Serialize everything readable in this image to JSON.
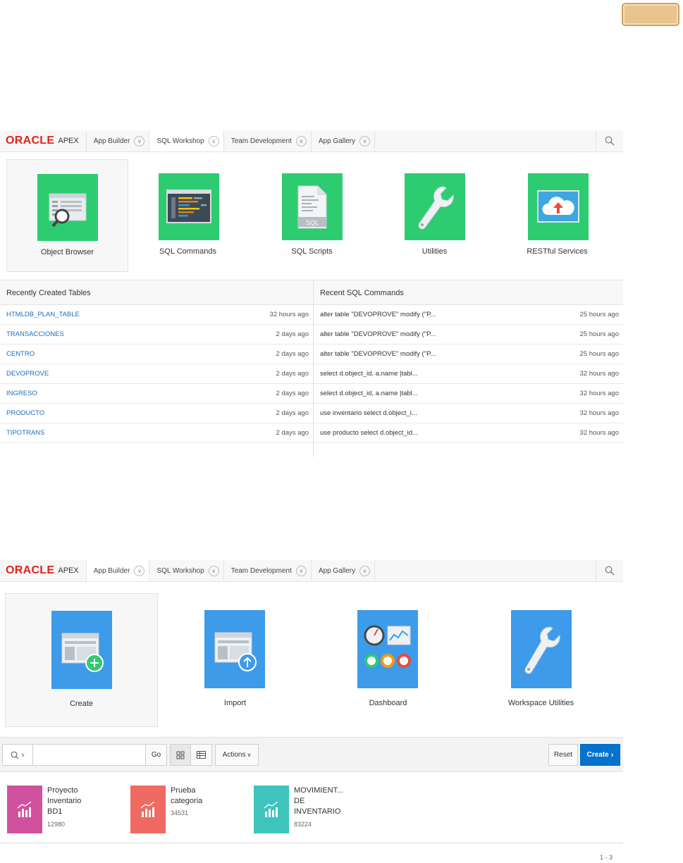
{
  "top_section": {
    "logo": {
      "brand": "ORACLE",
      "product": "APEX"
    },
    "nav": [
      {
        "label": "App Builder"
      },
      {
        "label": "SQL Workshop"
      },
      {
        "label": "Team Development"
      },
      {
        "label": "App Gallery"
      }
    ],
    "active_tab": "SQL Workshop",
    "tiles": [
      {
        "label": "Object Browser",
        "icon": "object-browser-icon",
        "selected": true
      },
      {
        "label": "SQL Commands",
        "icon": "sql-commands-icon"
      },
      {
        "label": "SQL Scripts",
        "icon": "sql-scripts-icon"
      },
      {
        "label": "Utilities",
        "icon": "wrench-icon"
      },
      {
        "label": "RESTful Services",
        "icon": "cloud-upload-icon"
      }
    ],
    "tile_color": "#2ecc71",
    "recent_tables": {
      "title": "Recently Created Tables",
      "rows": [
        {
          "name": "HTMLDB_PLAN_TABLE",
          "ago": "32 hours ago"
        },
        {
          "name": "TRANSACCIONES",
          "ago": "2 days ago"
        },
        {
          "name": "CENTRO",
          "ago": "2 days ago"
        },
        {
          "name": "DEVOPROVE",
          "ago": "2 days ago"
        },
        {
          "name": "INGRESO",
          "ago": "2 days ago"
        },
        {
          "name": "PRODUCTO",
          "ago": "2 days ago"
        },
        {
          "name": "TIPOTRANS",
          "ago": "2 days ago"
        }
      ]
    },
    "recent_sql": {
      "title": "Recent SQL Commands",
      "rows": [
        {
          "command": "alter table \"DEVOPROVE\" modify (\"P...",
          "ago": "25 hours ago"
        },
        {
          "command": "alter table \"DEVOPROVE\" modify (\"P...",
          "ago": "25 hours ago"
        },
        {
          "command": "alter table \"DEVOPROVE\" modify (\"P...",
          "ago": "25 hours ago"
        },
        {
          "command": "select d.object_id, a.name |tabl...",
          "ago": "32 hours ago"
        },
        {
          "command": "select d.object_id, a.name |tabl...",
          "ago": "32 hours ago"
        },
        {
          "command": "use inventario select d.object_i...",
          "ago": "32 hours ago"
        },
        {
          "command": "use producto select d.object_id...",
          "ago": "32 hours ago"
        }
      ]
    }
  },
  "bottom_section": {
    "logo": {
      "brand": "ORACLE",
      "product": "APEX"
    },
    "nav": [
      {
        "label": "App Builder"
      },
      {
        "label": "SQL Workshop"
      },
      {
        "label": "Team Development"
      },
      {
        "label": "App Gallery"
      }
    ],
    "active_tab": "App Builder",
    "tiles": [
      {
        "label": "Create",
        "icon": "create-app-icon",
        "selected": true
      },
      {
        "label": "Import",
        "icon": "import-icon"
      },
      {
        "label": "Dashboard",
        "icon": "dashboard-icon"
      },
      {
        "label": "Workspace Utilities",
        "icon": "wrench-icon"
      }
    ],
    "tile_color": "#3d9be9",
    "toolbar": {
      "search_value": "",
      "go_label": "Go",
      "actions_label": "Actions",
      "reset_label": "Reset",
      "create_label": "Create"
    },
    "apps": [
      {
        "name": "Proyecto Inventario BD1",
        "id": "12980",
        "color": "#d0529f"
      },
      {
        "name": "Prueba categoria",
        "id": "34531",
        "color": "#ee6a63"
      },
      {
        "name": "MOVIMIENT... DE INVENTARIO",
        "id": "83224",
        "color": "#3fc3bd"
      }
    ],
    "pagination": "1 - 3"
  }
}
